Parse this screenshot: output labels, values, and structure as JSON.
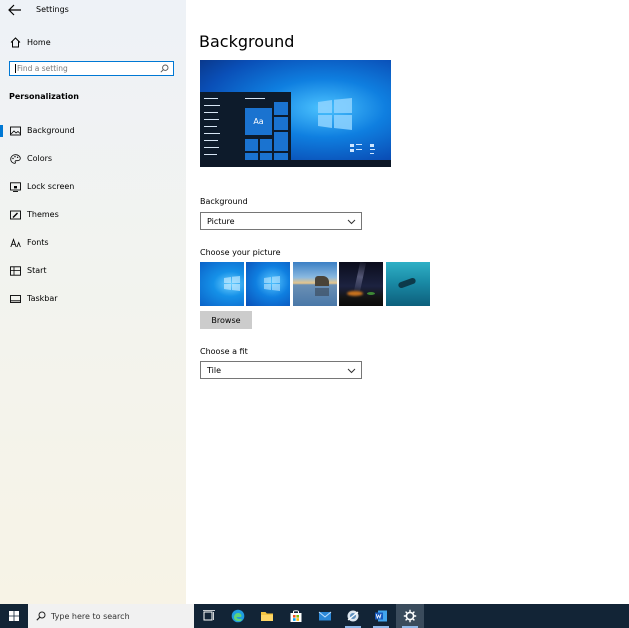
{
  "window": {
    "title": "Settings"
  },
  "sidebar": {
    "home_label": "Home",
    "search_placeholder": "Find a setting",
    "section": "Personalization",
    "items": [
      {
        "label": "Background",
        "icon": "image-icon",
        "active": true
      },
      {
        "label": "Colors",
        "icon": "palette-icon",
        "active": false
      },
      {
        "label": "Lock screen",
        "icon": "lock-screen-icon",
        "active": false
      },
      {
        "label": "Themes",
        "icon": "themes-icon",
        "active": false
      },
      {
        "label": "Fonts",
        "icon": "fonts-icon",
        "active": false
      },
      {
        "label": "Start",
        "icon": "start-icon",
        "active": false
      },
      {
        "label": "Taskbar",
        "icon": "taskbar-icon",
        "active": false
      }
    ]
  },
  "main": {
    "title": "Background",
    "preview_tile_text": "Aa",
    "background_label": "Background",
    "background_value": "Picture",
    "choose_picture_label": "Choose your picture",
    "pictures": [
      "Windows blue light",
      "Windows blue",
      "Beach reflection",
      "Night sky",
      "Underwater diver"
    ],
    "browse_label": "Browse",
    "fit_label": "Choose a fit",
    "fit_value": "Tile"
  },
  "taskbar": {
    "search_placeholder": "Type here to search",
    "apps": [
      "Task View",
      "Microsoft Edge",
      "File Explorer",
      "Microsoft Store",
      "Mail",
      "Snipping Tool",
      "Word",
      "Settings"
    ]
  },
  "colors": {
    "accent": "#0078d4",
    "taskbar": "#122436"
  }
}
